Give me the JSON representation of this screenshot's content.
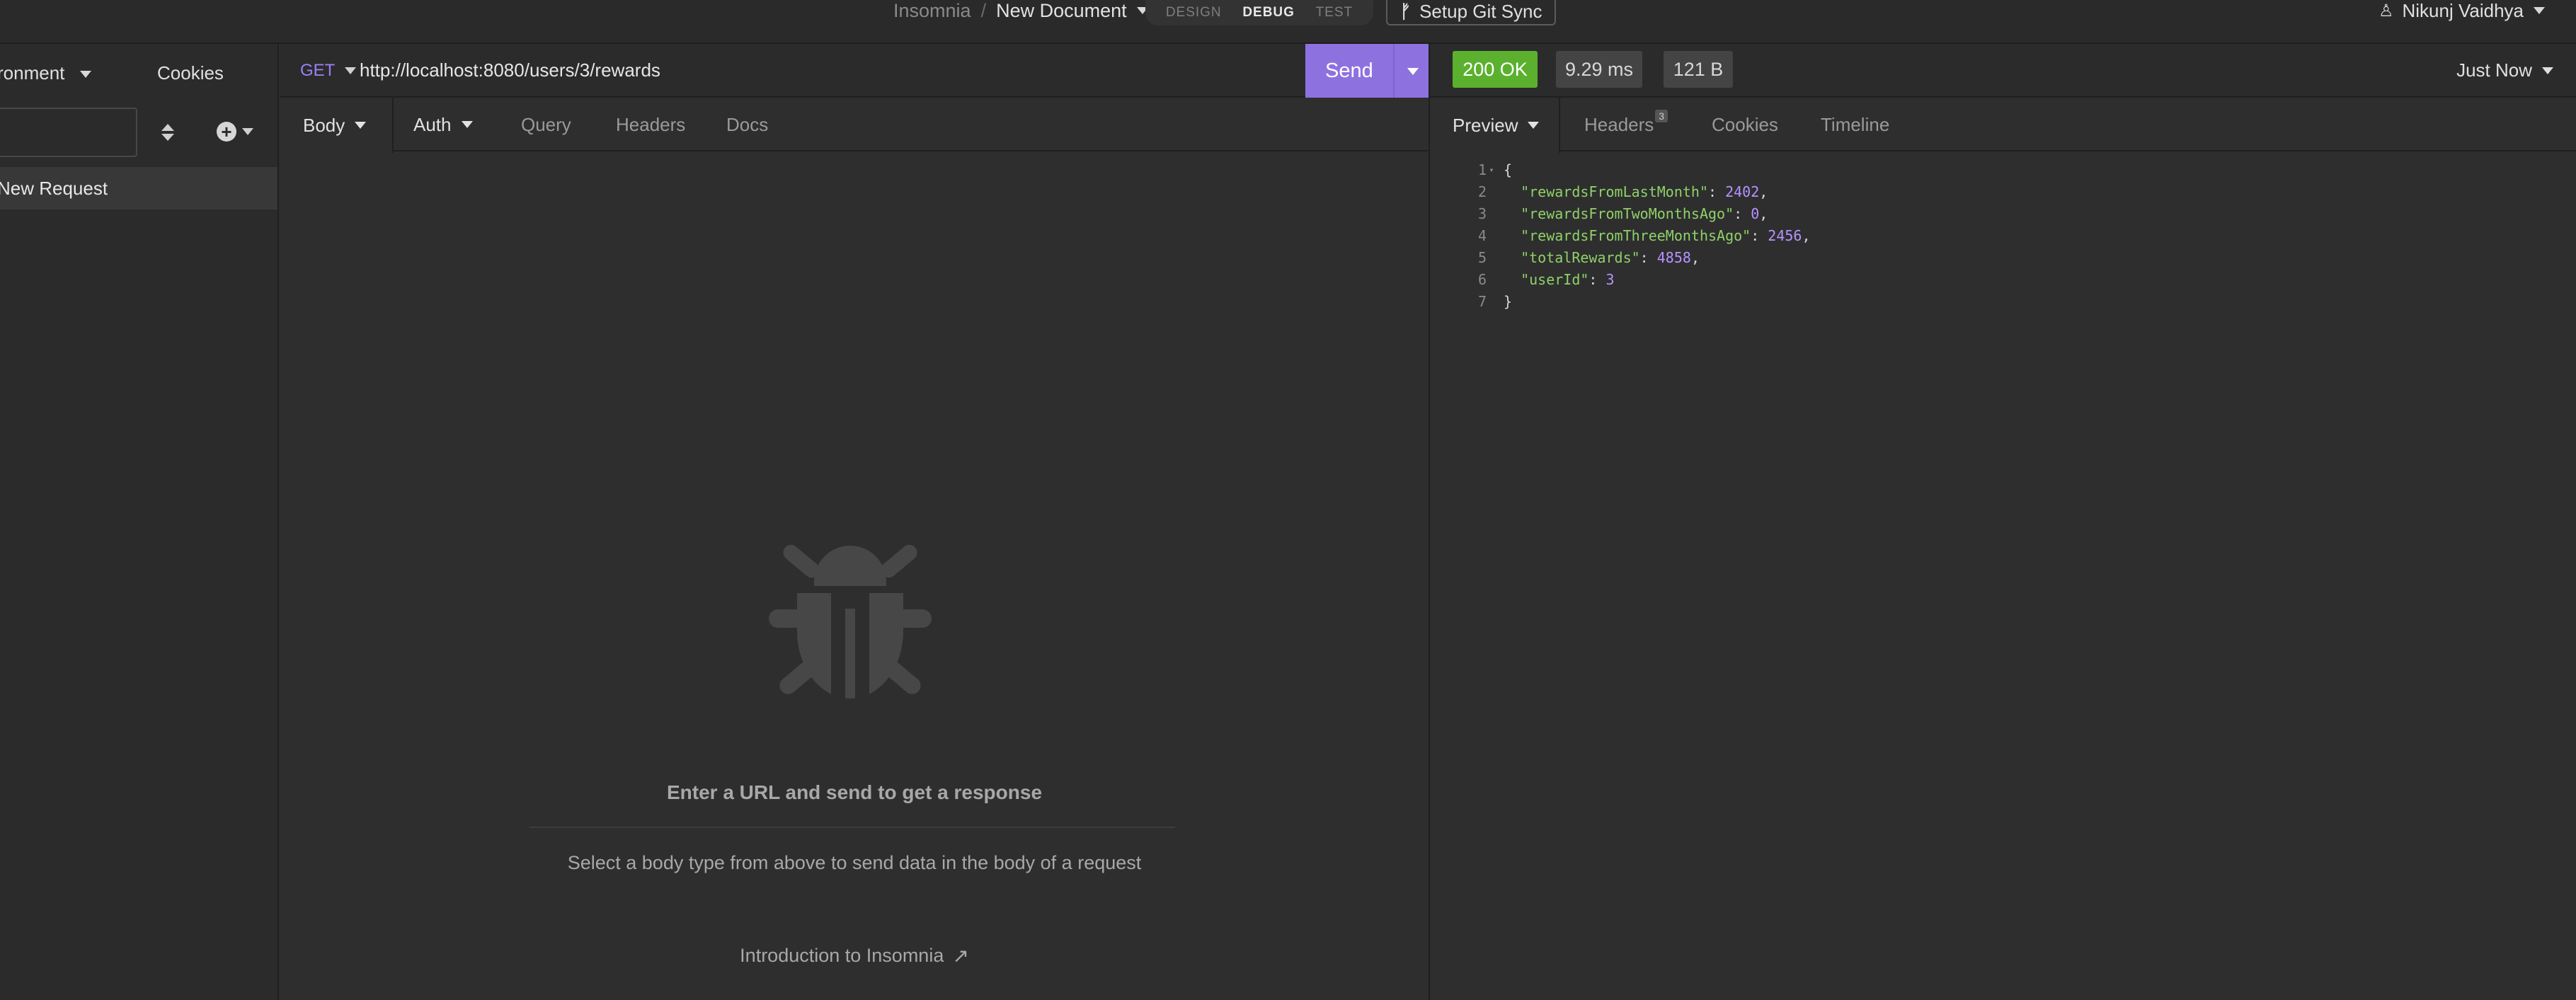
{
  "topbar": {
    "app_name": "Insomnia",
    "separator": "/",
    "document_name": "New Document",
    "modes": [
      "DESIGN",
      "DEBUG",
      "TEST"
    ],
    "active_mode": "DEBUG",
    "git_sync_label": "Setup Git Sync",
    "user_name": "Nikunj Vaidhya"
  },
  "sidebar": {
    "environment_label": "ronment",
    "cookies_label": "Cookies",
    "filter_placeholder": "",
    "requests": [
      {
        "label": "New Request",
        "selected": true
      }
    ]
  },
  "request": {
    "method": "GET",
    "url": "http://localhost:8080/users/3/rewards",
    "send_label": "Send",
    "tabs": [
      {
        "label": "Body",
        "has_dropdown": true,
        "active": true
      },
      {
        "label": "Auth",
        "has_dropdown": true
      },
      {
        "label": "Query"
      },
      {
        "label": "Headers"
      },
      {
        "label": "Docs"
      }
    ],
    "empty_title": "Enter a URL and send to get a response",
    "empty_subtitle": "Select a body type from above to send data in the body of a request",
    "intro_link": "Introduction to Insomnia"
  },
  "response": {
    "status": "200 OK",
    "time": "9.29 ms",
    "size": "121 B",
    "history_label": "Just Now",
    "tabs": [
      {
        "label": "Preview",
        "has_dropdown": true,
        "active": true
      },
      {
        "label": "Headers",
        "count": "3"
      },
      {
        "label": "Cookies"
      },
      {
        "label": "Timeline"
      }
    ],
    "body_lines": [
      {
        "n": "1",
        "text": "{"
      },
      {
        "n": "2",
        "key": "\"rewardsFromLastMonth\"",
        "value": "2402",
        "trail": ","
      },
      {
        "n": "3",
        "key": "\"rewardsFromTwoMonthsAgo\"",
        "value": "0",
        "trail": ","
      },
      {
        "n": "4",
        "key": "\"rewardsFromThreeMonthsAgo\"",
        "value": "2456",
        "trail": ","
      },
      {
        "n": "5",
        "key": "\"totalRewards\"",
        "value": "4858",
        "trail": ","
      },
      {
        "n": "6",
        "key": "\"userId\"",
        "value": "3",
        "trail": ""
      },
      {
        "n": "7",
        "text": "}"
      }
    ]
  },
  "colors": {
    "accent": "#8d72df",
    "status_ok": "#5bb12e",
    "json_key": "#8fd16a",
    "json_number": "#b792ff"
  }
}
